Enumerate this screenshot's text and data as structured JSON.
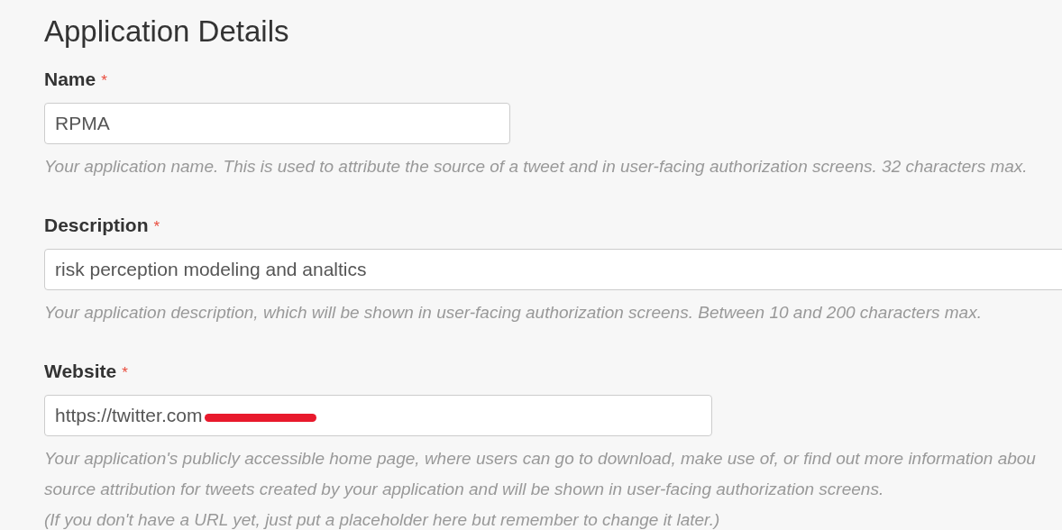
{
  "section": {
    "title": "Application Details"
  },
  "fields": [
    {
      "label": "Name",
      "required_mark": "*",
      "value": "RPMA",
      "help": [
        "Your application name. This is used to attribute the source of a tweet and in user-facing authorization screens. 32 characters max."
      ]
    },
    {
      "label": "Description",
      "required_mark": "*",
      "value": "risk perception modeling and analtics",
      "help": [
        "Your application description, which will be shown in user-facing authorization screens. Between 10 and 200 characters max."
      ]
    },
    {
      "label": "Website",
      "required_mark": "*",
      "value": "https://twitter.com",
      "redacted": true,
      "help": [
        "Your application's publicly accessible home page, where users can go to download, make use of, or find out more information abou",
        "source attribution for tweets created by your application and will be shown in user-facing authorization screens.",
        "(If you don't have a URL yet, just put a placeholder here but remember to change it later.)"
      ]
    }
  ]
}
